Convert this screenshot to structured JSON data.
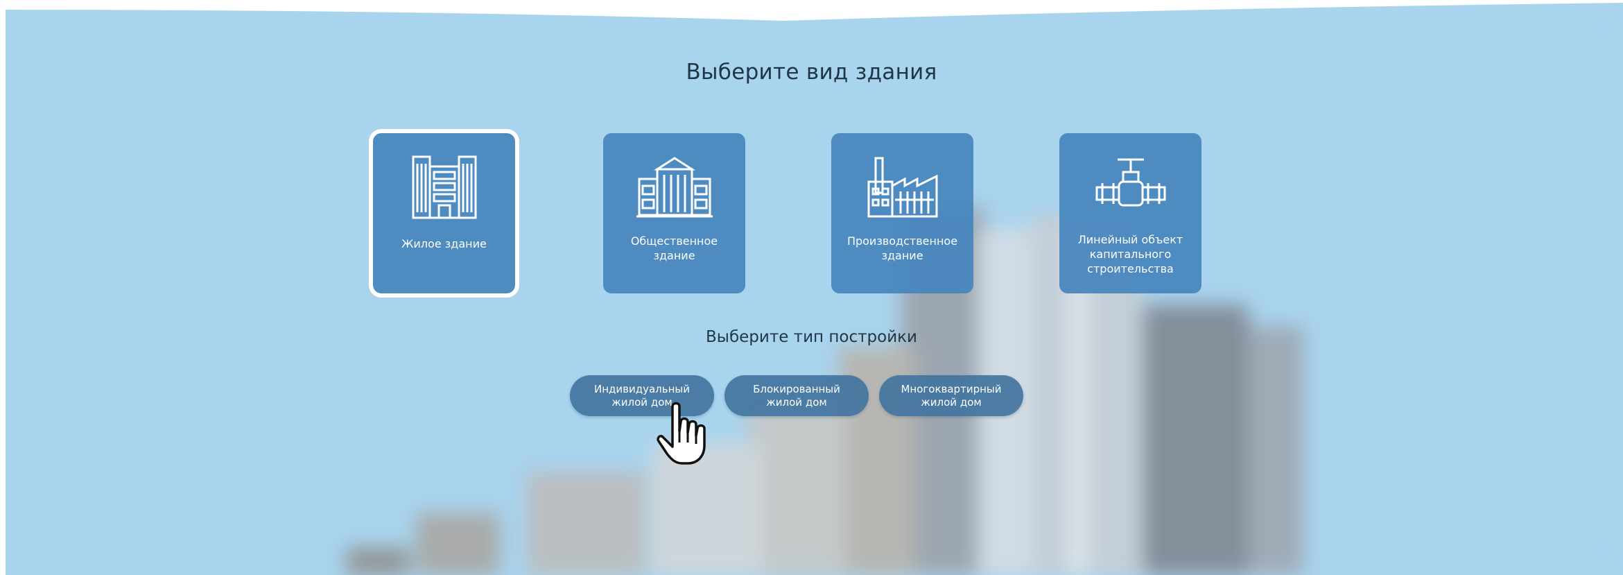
{
  "heading": "Выберите вид здания",
  "building_types": [
    {
      "label": "Жилое здание",
      "icon": "residential-building-icon",
      "selected": true
    },
    {
      "label": "Общественное\nздание",
      "icon": "public-building-icon",
      "selected": false
    },
    {
      "label": "Производственное\nздание",
      "icon": "factory-icon",
      "selected": false
    },
    {
      "label": "Линейный объект\nкапитального\nстроительства",
      "icon": "pipeline-valve-icon",
      "selected": false
    }
  ],
  "subheading": "Выберите тип постройки",
  "construction_types": [
    {
      "label": "Индивидуальный\nжилой дом"
    },
    {
      "label": "Блокированный\nжилой дом"
    },
    {
      "label": "Многоквартирный\nжилой дом"
    }
  ],
  "cursor": "hand-pointer-icon",
  "colors": {
    "background": "#a9d4ee",
    "card": "#4685bd",
    "pill": "#4274a0",
    "text_dark": "#1f3646"
  }
}
